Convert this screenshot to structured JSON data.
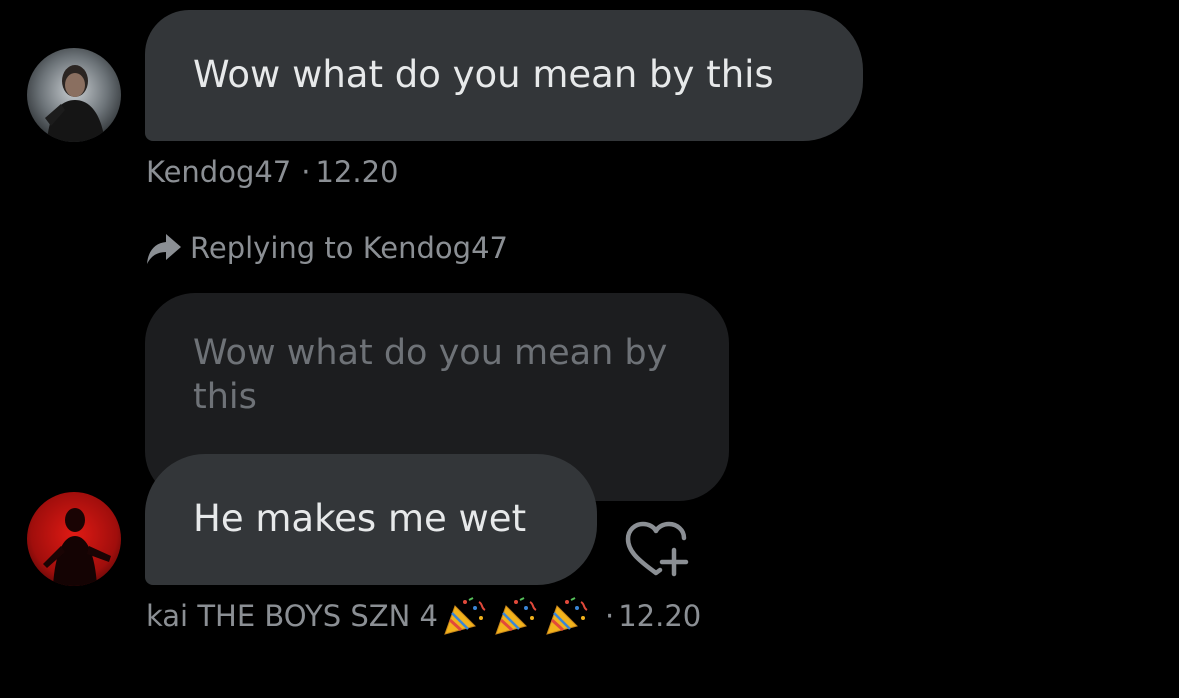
{
  "messages": [
    {
      "text": "Wow what do you mean by this",
      "sender": "Kendog47",
      "time": "12.20",
      "separator": "·",
      "avatar_icon": "user-avatar-icon"
    },
    {
      "replying_label": "Replying to Kendog47",
      "quoted_text": "Wow what do you mean by this",
      "text": "He makes me wet",
      "sender": "kai THE BOYS SZN 4",
      "sender_emoji": [
        "party-popper-icon",
        "party-popper-icon",
        "party-popper-icon"
      ],
      "time": "12.20",
      "separator": "·",
      "avatar_icon": "user-avatar-icon",
      "reaction_button_icon": "add-reaction-heart-icon"
    }
  ],
  "colors": {
    "background": "#000000",
    "bubble": "#333639",
    "quoted_bubble": "#1c1d1f",
    "meta_text": "#8b8f94",
    "message_text": "#e7e9ea"
  }
}
